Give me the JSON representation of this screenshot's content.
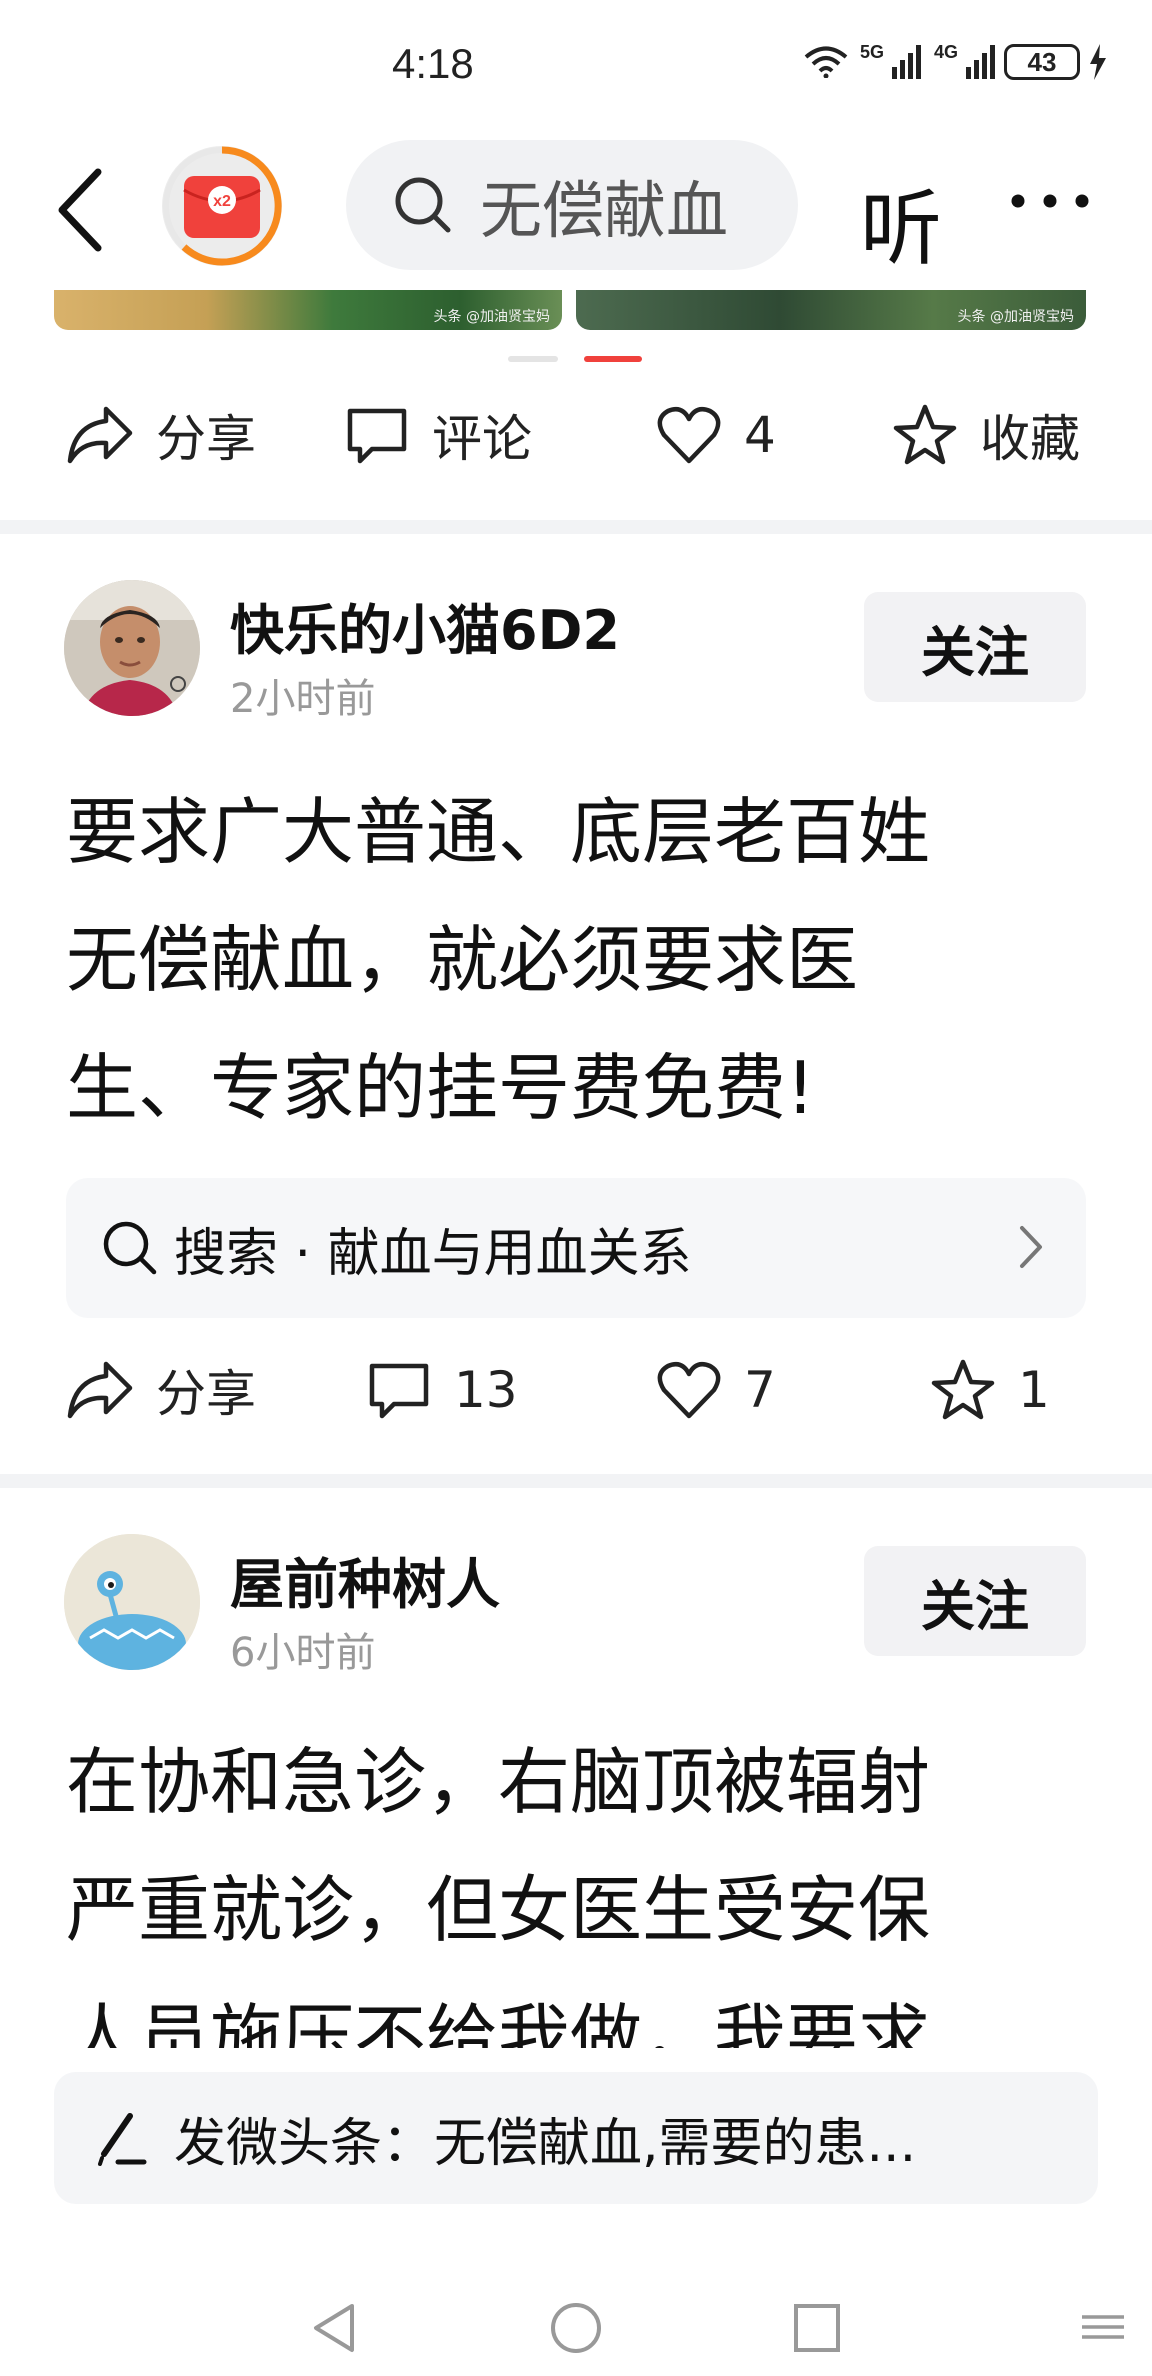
{
  "status_bar": {
    "time": "4:18",
    "network_1": "5G",
    "network_2": "4G",
    "battery": "43"
  },
  "top_nav": {
    "redpack_badge": "x2",
    "search_text": "无偿献血",
    "listen_label": "听"
  },
  "image_strip": {
    "caption_left": "头条 @加油贤宝妈",
    "caption_right": "头条 @加油贤宝妈"
  },
  "first_post_actions": {
    "share": "分享",
    "comment": "评论",
    "likes": "4",
    "favorite": "收藏"
  },
  "post_1": {
    "username": "快乐的小猫6D2",
    "time": "2小时前",
    "follow": "关注",
    "body_lines": [
      "要求广大普通、底层老百姓",
      "无偿献血，就必须要求医",
      "生、专家的挂号费免费!"
    ],
    "search_hint": "搜索 · 献血与用血关系",
    "actions": {
      "share": "分享",
      "comments": "13",
      "likes": "7",
      "favorites": "1"
    }
  },
  "post_2": {
    "username": "屋前种树人",
    "time": "6小时前",
    "follow": "关注",
    "body_lines": [
      "在协和急诊，右脑顶被辐射",
      "严重就诊，但女医生受安保",
      "人员施压不给我做，我要求"
    ]
  },
  "composer": {
    "text": "发微头条：无偿献血,需要的患..."
  },
  "colors": {
    "accent_red": "#f0413c",
    "ring_orange": "#f78a1d",
    "divider": "#f2f3f5"
  }
}
